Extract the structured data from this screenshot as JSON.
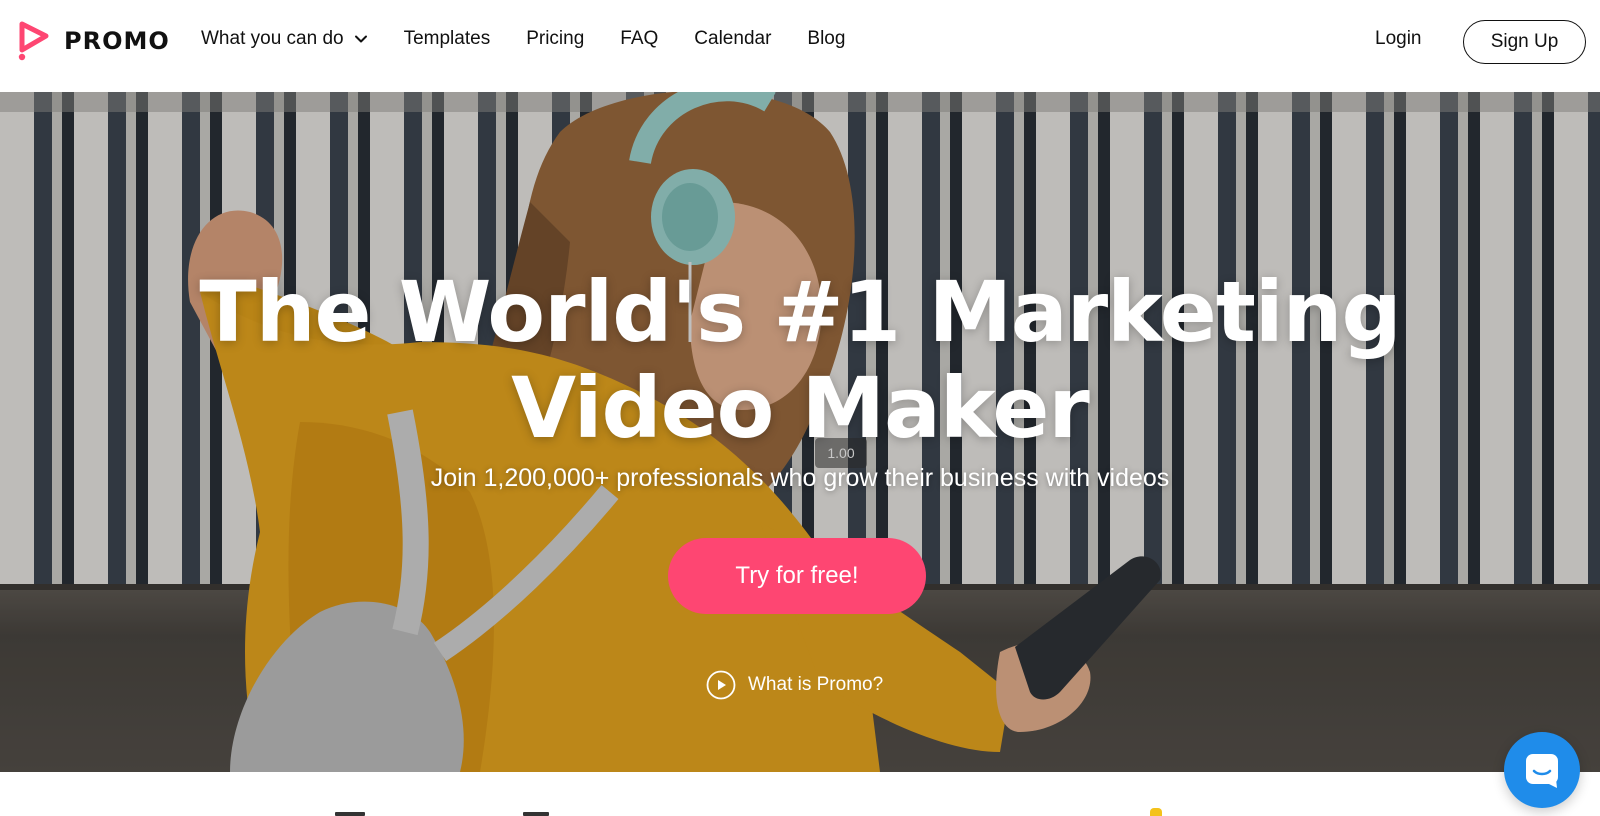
{
  "brand": {
    "name": "PROMO",
    "color": "#fe4672"
  },
  "nav": {
    "items": [
      {
        "label": "What you can do",
        "has_dropdown": true
      },
      {
        "label": "Templates"
      },
      {
        "label": "Pricing"
      },
      {
        "label": "FAQ"
      },
      {
        "label": "Calendar"
      },
      {
        "label": "Blog"
      }
    ],
    "login_label": "Login",
    "signup_label": "Sign Up"
  },
  "hero": {
    "title_line1": "The World's #1 Marketing",
    "title_line2": "Video Maker",
    "subtitle": "Join 1,200,000+ professionals who grow their business with videos",
    "speed_badge": "1.00",
    "cta_label": "Try for free!",
    "cta_color": "#fe4672",
    "what_is_label": "What is Promo?"
  },
  "chat": {
    "icon": "chat-icon",
    "color": "#1f8cea"
  }
}
